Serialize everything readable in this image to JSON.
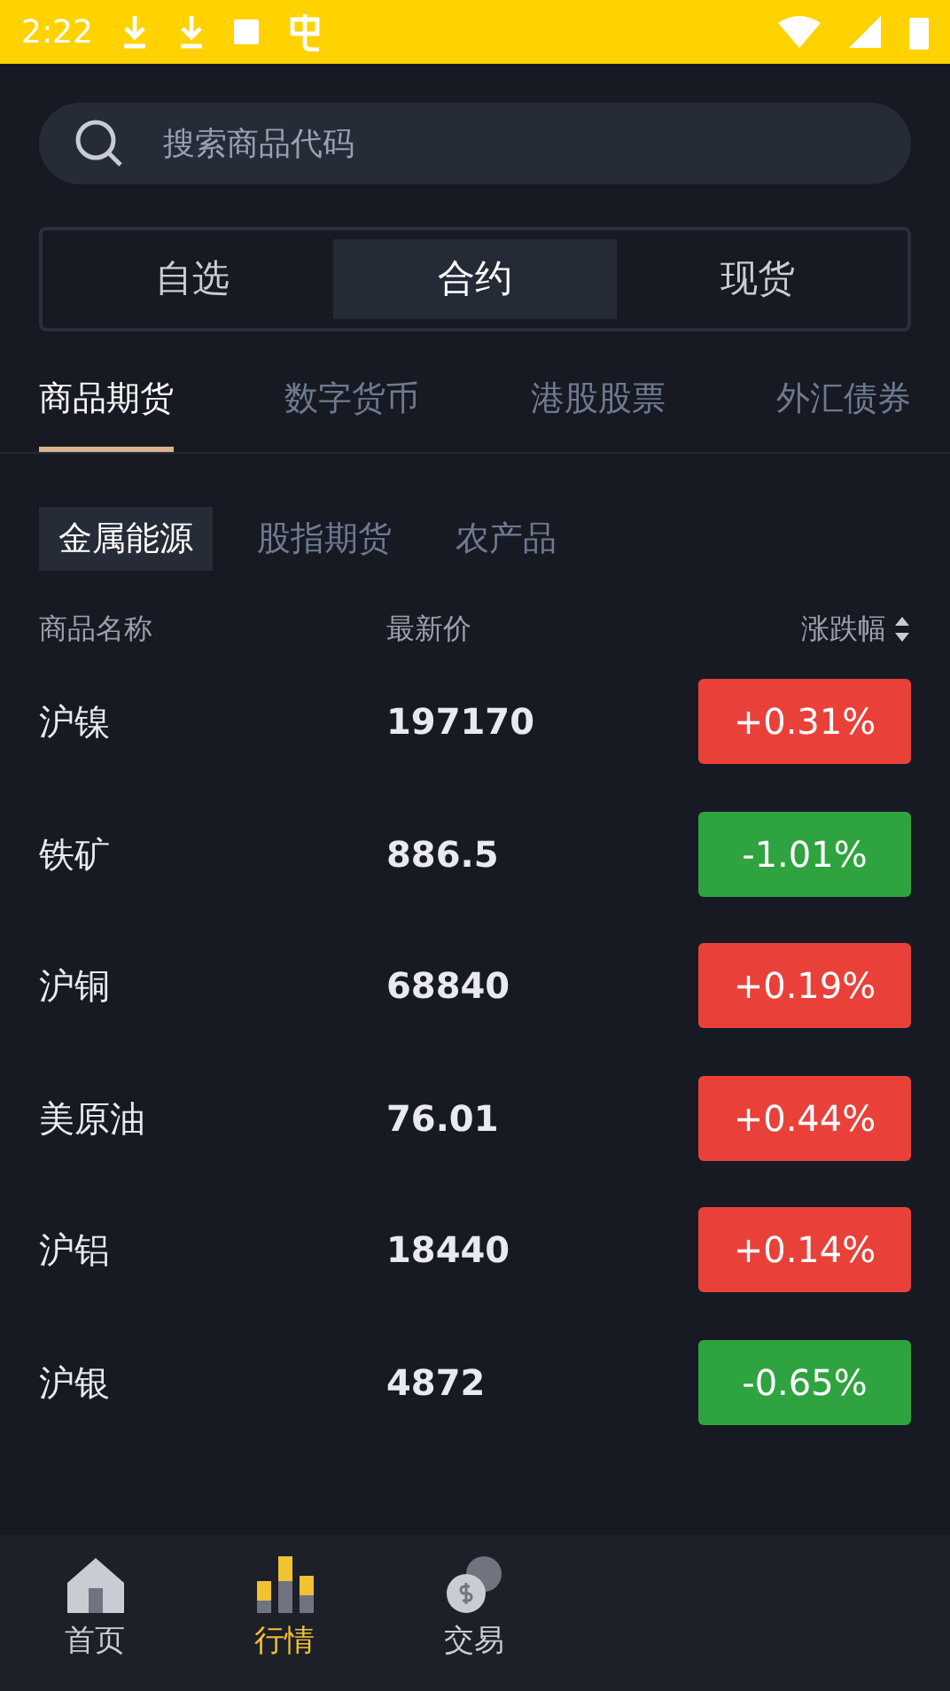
{
  "status_bar": {
    "time": "2:22"
  },
  "search": {
    "placeholder": "搜索商品代码"
  },
  "segments": [
    {
      "label": "自选",
      "selected": false
    },
    {
      "label": "合约",
      "selected": true
    },
    {
      "label": "现货",
      "selected": false
    }
  ],
  "tabs": [
    {
      "label": "商品期货",
      "selected": true
    },
    {
      "label": "数字货币",
      "selected": false
    },
    {
      "label": "港股股票",
      "selected": false
    },
    {
      "label": "外汇债券",
      "selected": false
    }
  ],
  "sub_tabs": [
    {
      "label": "金属能源",
      "selected": true
    },
    {
      "label": "股指期货",
      "selected": false
    },
    {
      "label": "农产品",
      "selected": false
    }
  ],
  "table": {
    "columns": [
      "商品名称",
      "最新价",
      "涨跌幅"
    ],
    "rows": [
      {
        "name": "沪镍",
        "price": "197170",
        "change": "+0.31%",
        "color": "#e9413a"
      },
      {
        "name": "铁矿",
        "price": "886.5",
        "change": "-1.01%",
        "color": "#2fa33f"
      },
      {
        "name": "沪铜",
        "price": "68840",
        "change": "+0.19%",
        "color": "#e9413a"
      },
      {
        "name": "美原油",
        "price": "76.01",
        "change": "+0.44%",
        "color": "#e9413a"
      },
      {
        "name": "沪铝",
        "price": "18440",
        "change": "+0.14%",
        "color": "#e9413a"
      },
      {
        "name": "沪银",
        "price": "4872",
        "change": "-0.65%",
        "color": "#2fa33f"
      }
    ]
  },
  "bottom_nav": [
    {
      "label": "首页",
      "kind": "home",
      "selected": false
    },
    {
      "label": "行情",
      "kind": "market",
      "selected": true
    },
    {
      "label": "交易",
      "kind": "trade",
      "selected": false
    }
  ]
}
